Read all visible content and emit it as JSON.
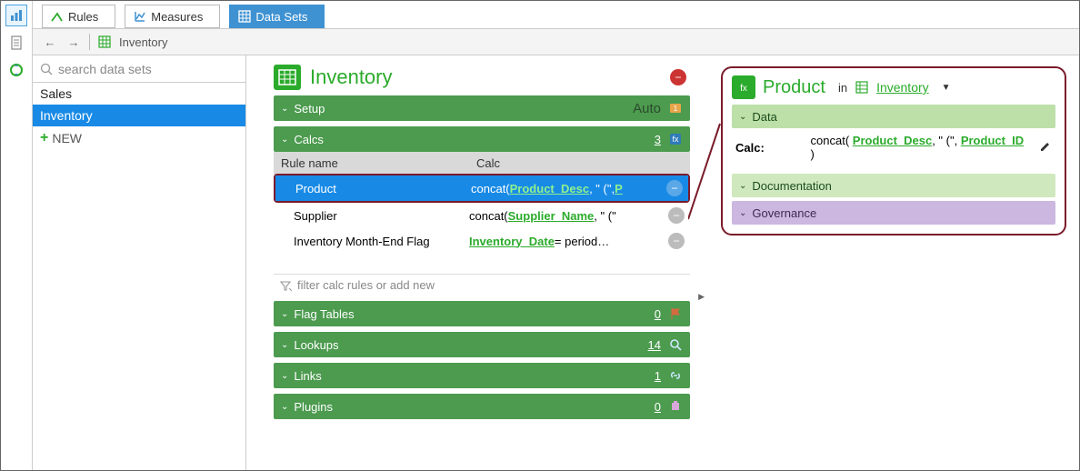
{
  "rail": {
    "icons": [
      "chart-icon",
      "doc-icon",
      "cycle-icon"
    ]
  },
  "tabs": {
    "rules": "Rules",
    "measures": "Measures",
    "datasets": "Data Sets"
  },
  "nav": {
    "breadcrumb": "Inventory"
  },
  "search": {
    "placeholder": "search data sets"
  },
  "sidebar": {
    "items": [
      "Sales",
      "Inventory"
    ],
    "selected": 1,
    "new_label": "NEW"
  },
  "dataset": {
    "title": "Inventory",
    "setup": {
      "label": "Setup",
      "mode": "Auto"
    },
    "calcs": {
      "label": "Calcs",
      "count": "3",
      "header_name": "Rule name",
      "header_calc": "Calc",
      "rows": [
        {
          "name": "Product",
          "prefix": "concat( ",
          "link": "Product_Desc",
          "suffix": ", \" (\", ",
          "link2": "P"
        },
        {
          "name": "Supplier",
          "prefix": "concat( ",
          "link": "Supplier_Name",
          "suffix": ", \" (\""
        },
        {
          "name": "Inventory Month-End Flag",
          "prefix": "",
          "link": "Inventory_Date",
          "suffix": " = period…"
        }
      ],
      "filter_placeholder": "filter calc rules or add new"
    },
    "flag_tables": {
      "label": "Flag Tables",
      "count": "0"
    },
    "lookups": {
      "label": "Lookups",
      "count": "14"
    },
    "links": {
      "label": "Links",
      "count": "1"
    },
    "plugins": {
      "label": "Plugins",
      "count": "0"
    }
  },
  "detail": {
    "title": "Product",
    "in_label": "in",
    "dataset_link": "Inventory",
    "data_label": "Data",
    "calc_label": "Calc:",
    "calc_prefix": "concat( ",
    "calc_link1": "Product_Desc",
    "calc_mid": ", \" (\", ",
    "calc_link2": "Product_ID",
    "calc_suffix": " )",
    "doc_label": "Documentation",
    "gov_label": "Governance"
  }
}
